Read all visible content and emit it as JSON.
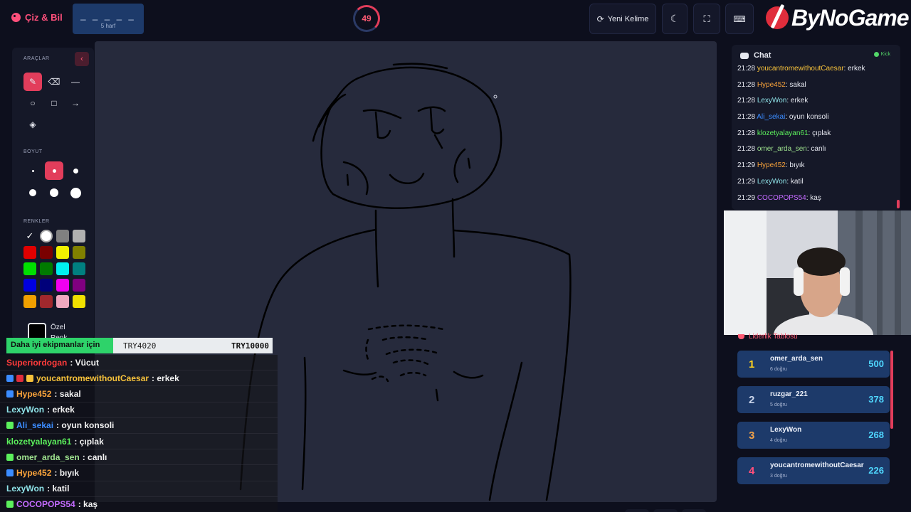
{
  "header": {
    "brand": "Çiz & Bil",
    "word_blanks": "_ _ _ _ _",
    "word_hint": "5 harf",
    "timer": "49",
    "new_word": "Yeni Kelime",
    "logo": "ByNoGame"
  },
  "tools": {
    "title": "ARAÇLAR",
    "size_title": "BOYUT",
    "colors_title": "RENKLER",
    "custom_label_1": "Özel",
    "custom_label_2": "Renk",
    "colors": [
      "#ffffff",
      "#ffffff",
      "#808080",
      "#b0b0b0",
      "#e00000",
      "#7a0000",
      "#f0f000",
      "#808000",
      "#00e000",
      "#007a00",
      "#00f0f0",
      "#008080",
      "#0000e0",
      "#00007a",
      "#f000f0",
      "#800080",
      "#f0a000",
      "#a0282d",
      "#f0a8c0",
      "#f0e000"
    ]
  },
  "donation": {
    "label": "Daha iyi ekipmanlar için",
    "current": "TRY4020",
    "goal": "TRY10000",
    "progress": 0.402
  },
  "overlay_chat": [
    {
      "user": "Superiordogan",
      "msg": ": Vücut",
      "color": "#ff3b3b"
    },
    {
      "user": "youcantromewithoutCaesar",
      "msg": ": erkek",
      "color": "#f7c23b"
    },
    {
      "user": "Hype452",
      "msg": ": sakal",
      "color": "#f7a23b"
    },
    {
      "user": "LexyWon",
      "msg": ": erkek",
      "color": "#8fe3e8"
    },
    {
      "user": "Ali_sekai",
      "msg": ": oyun konsoli",
      "color": "#3b8cff"
    },
    {
      "user": "klozetyalayan61",
      "msg": ": çıplak",
      "color": "#5cf05c"
    },
    {
      "user": "omer_arda_sen",
      "msg": ": canlı",
      "color": "#9fe38f"
    },
    {
      "user": "Hype452",
      "msg": ": bıyık",
      "color": "#f7a23b"
    },
    {
      "user": "LexyWon",
      "msg": ": katil",
      "color": "#8fe3e8"
    },
    {
      "user": "COCOPOPS54",
      "msg": ": kaş",
      "color": "#c46bff"
    }
  ],
  "chat": {
    "title": "Chat",
    "source": "Kick",
    "lines": [
      {
        "time": "21:28",
        "user": "youcantromewithoutCaesar",
        "msg": ": erkek",
        "color": "#f7c23b"
      },
      {
        "time": "21:28",
        "user": "Hype452",
        "msg": ": sakal",
        "color": "#f7a23b"
      },
      {
        "time": "21:28",
        "user": "LexyWon",
        "msg": ": erkek",
        "color": "#8fe3e8"
      },
      {
        "time": "21:28",
        "user": "Ali_sekai",
        "msg": ": oyun konsoli",
        "color": "#3b8cff"
      },
      {
        "time": "21:28",
        "user": "klozetyalayan61",
        "msg": ": çıplak",
        "color": "#5cf05c"
      },
      {
        "time": "21:28",
        "user": "omer_arda_sen",
        "msg": ": canlı",
        "color": "#9fe38f"
      },
      {
        "time": "21:29",
        "user": "Hype452",
        "msg": ": bıyık",
        "color": "#f7a23b"
      },
      {
        "time": "21:29",
        "user": "LexyWon",
        "msg": ": katil",
        "color": "#8fe3e8"
      },
      {
        "time": "21:29",
        "user": "COCOPOPS54",
        "msg": ": kaş",
        "color": "#c46bff"
      }
    ]
  },
  "leaderboard": {
    "title": "Liderlik Tablosu",
    "rows": [
      {
        "rank": "1",
        "name": "omer_arda_sen",
        "sub": "6 doğru",
        "score": "500",
        "color": "#ffd21f"
      },
      {
        "rank": "2",
        "name": "ruzgar_221",
        "sub": "5 doğru",
        "score": "378",
        "color": "#c9d4ea"
      },
      {
        "rank": "3",
        "name": "LexyWon",
        "sub": "4 doğru",
        "score": "268",
        "color": "#f0a24a"
      },
      {
        "rank": "4",
        "name": "youcantromewithoutCaesar",
        "sub": "3 doğru",
        "score": "226",
        "color": "#ff4f7b"
      }
    ]
  }
}
